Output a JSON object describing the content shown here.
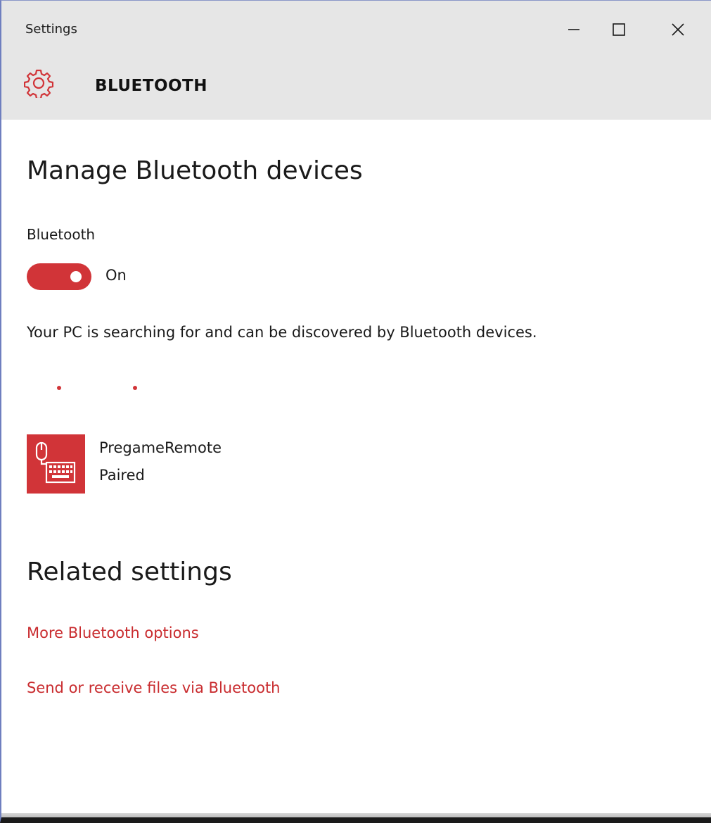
{
  "window": {
    "title": "Settings",
    "minimize_icon": "minimize-icon",
    "maximize_icon": "maximize-icon",
    "close_icon": "close-icon"
  },
  "header": {
    "icon": "gear-icon",
    "title": "BLUETOOTH"
  },
  "main": {
    "heading": "Manage Bluetooth devices",
    "bluetooth_label": "Bluetooth",
    "toggle_state": "On",
    "toggle_on": true,
    "status": "Your PC is searching for and can be discovered by Bluetooth devices."
  },
  "devices": [
    {
      "icon": "mouse-keyboard-icon",
      "name": "PregameRemote",
      "status": "Paired"
    }
  ],
  "related": {
    "heading": "Related settings",
    "links": [
      {
        "label": "More Bluetooth options"
      },
      {
        "label": "Send or receive files via Bluetooth"
      }
    ]
  },
  "colors": {
    "accent": "#d13438",
    "titlebar_bg": "#e6e6e6",
    "text": "#1a1a1a"
  }
}
